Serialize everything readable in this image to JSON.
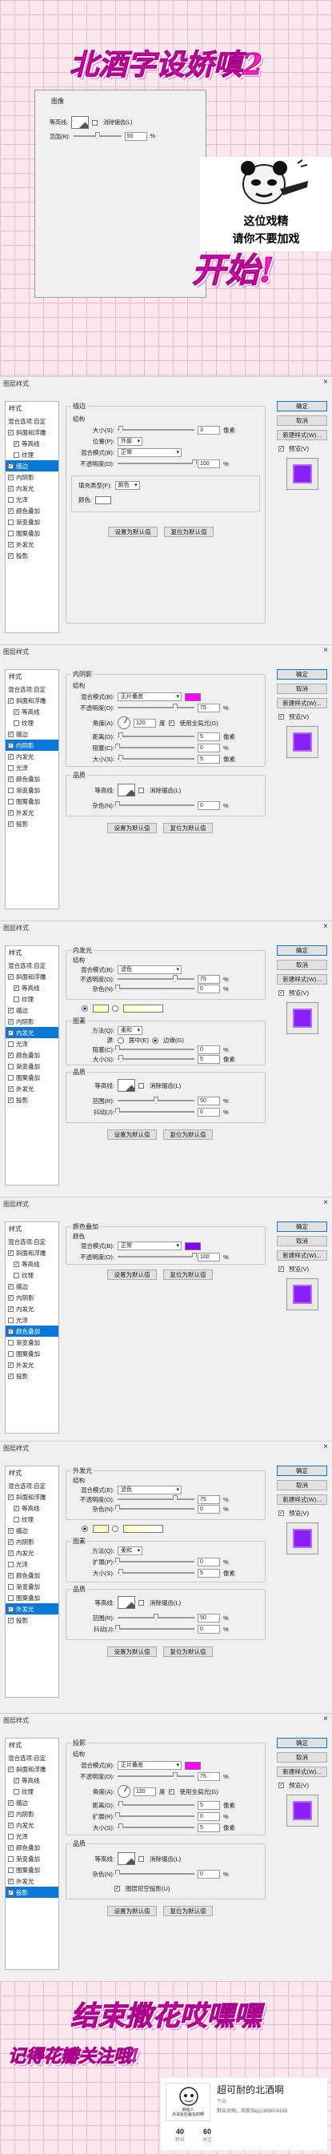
{
  "header": {
    "title": "北酒字设娇嗔2",
    "start": "开始!",
    "mini_panel": {
      "legend": "图像",
      "row1_label": "等高线:",
      "row1_check": "消除锯齿(L)",
      "row2_label": "范围(R):",
      "row2_value": "50",
      "row2_unit": "%"
    },
    "meme": {
      "line1": "这位戏精",
      "line2": "请你不要加戏"
    }
  },
  "common": {
    "dialog_title": "图层样式",
    "close": "×",
    "styles_header": "样式",
    "blend_options": "混合选项:自定",
    "ok": "确定",
    "cancel": "取消",
    "new_style": "新建样式(W)...",
    "preview": "预览(V)",
    "make_default": "设置为默认值",
    "reset_default": "复位为默认值",
    "pixels": "像素",
    "percent": "%"
  },
  "style_items": [
    {
      "label": "斜面和浮雕",
      "checked": true,
      "sub": false
    },
    {
      "label": "等高线",
      "checked": false,
      "sub": true
    },
    {
      "label": "纹理",
      "checked": false,
      "sub": true
    },
    {
      "label": "描边",
      "checked": true,
      "sub": false
    },
    {
      "label": "内阴影",
      "checked": true,
      "sub": false
    },
    {
      "label": "内发光",
      "checked": true,
      "sub": false
    },
    {
      "label": "光泽",
      "checked": false,
      "sub": false
    },
    {
      "label": "颜色叠加",
      "checked": true,
      "sub": false
    },
    {
      "label": "渐变叠加",
      "checked": false,
      "sub": false
    },
    {
      "label": "图案叠加",
      "checked": false,
      "sub": false
    },
    {
      "label": "外发光",
      "checked": true,
      "sub": false
    },
    {
      "label": "投影",
      "checked": true,
      "sub": false
    }
  ],
  "stroke": {
    "title": "描边",
    "structure": "结构",
    "size_label": "大小(S):",
    "size_value": "3",
    "position_label": "位置(P):",
    "position_value": "外部",
    "blend_label": "混合模式(B):",
    "blend_value": "正常",
    "opacity_label": "不透明度(O):",
    "opacity_value": "100",
    "fill_type_label": "填充类型(F):",
    "fill_type_value": "颜色",
    "color_label": "颜色:",
    "color": "#ffffff"
  },
  "inner_shadow": {
    "title": "内阴影",
    "structure": "结构",
    "blend_label": "混合模式(B):",
    "blend_value": "正片叠底",
    "opacity_label": "不透明度(O):",
    "opacity_value": "75",
    "angle_label": "角度(A):",
    "angle_value": "120",
    "angle_unit": "度",
    "global_light": "使用全局光(G)",
    "distance_label": "距离(D):",
    "distance_value": "5",
    "choke_label": "阻塞(C):",
    "choke_value": "0",
    "size_label": "大小(S):",
    "size_value": "5",
    "quality": "品质",
    "contour_label": "等高线:",
    "antialias": "消除锯齿(L)",
    "noise_label": "杂色(N):",
    "noise_value": "0",
    "color": "#ff00ff"
  },
  "inner_glow": {
    "title": "内发光",
    "structure": "结构",
    "blend_label": "混合模式(B):",
    "blend_value": "滤色",
    "opacity_label": "不透明度(O):",
    "opacity_value": "75",
    "noise_label": "杂色(N):",
    "noise_value": "0",
    "elements": "图素",
    "method_label": "方法(Q):",
    "method_value": "柔和",
    "source_label": "源:",
    "source_center": "居中(E)",
    "source_edge": "边缘(G)",
    "choke_label": "阻塞(C):",
    "choke_value": "0",
    "size_label": "大小(S):",
    "size_value": "5",
    "quality": "品质",
    "contour_label": "等高线:",
    "antialias": "消除锯齿(L)",
    "range_label": "范围(R):",
    "range_value": "50",
    "jitter_label": "抖动(J):",
    "jitter_value": "0",
    "color": "#ffffbe"
  },
  "color_overlay": {
    "title": "颜色叠加",
    "section": "颜色",
    "blend_label": "混合模式(B):",
    "blend_value": "正常",
    "opacity_label": "不透明度(O):",
    "opacity_value": "100",
    "color": "#8800ff"
  },
  "outer_glow": {
    "title": "外发光",
    "structure": "结构",
    "blend_label": "混合模式(E):",
    "blend_value": "滤色",
    "opacity_label": "不透明度(O):",
    "opacity_value": "75",
    "noise_label": "杂色(N):",
    "noise_value": "0",
    "elements": "图素",
    "method_label": "方法(Q):",
    "method_value": "柔和",
    "spread_label": "扩展(P):",
    "spread_value": "0",
    "size_label": "大小(S):",
    "size_value": "5",
    "quality": "品质",
    "contour_label": "等高线:",
    "antialias": "消除锯齿(L)",
    "range_label": "范围(R):",
    "range_value": "50",
    "jitter_label": "抖动(J):",
    "jitter_value": "0",
    "color": "#ffffbe"
  },
  "drop_shadow": {
    "title": "投影",
    "structure": "结构",
    "blend_label": "混合模式(B):",
    "blend_value": "正片叠底",
    "opacity_label": "不透明度(O):",
    "opacity_value": "75",
    "angle_label": "角度(A):",
    "angle_value": "120",
    "angle_unit": "度",
    "global_light": "使用全局光(G)",
    "distance_label": "距离(D):",
    "distance_value": "5",
    "spread_label": "扩展(R):",
    "spread_value": "0",
    "size_label": "大小(S):",
    "size_value": "5",
    "quality": "品质",
    "contour_label": "等高线:",
    "antialias": "消除锯齿(L)",
    "noise_label": "杂色(N):",
    "noise_value": "0",
    "knockout": "图层挖空投影(U)",
    "color": "#ff00ff"
  },
  "footer": {
    "end": "结束撒花哎嘿嘿",
    "follow": "记得花瓣关注哦!",
    "card_name": "超可耐的北酒啊",
    "card_sub": "不苦",
    "card_meta": "默告对图，商家加qq1365004165",
    "avatar_text": "来给人\n点没反应最在的啊",
    "stat1_value": "40",
    "stat1_label": "粉丝",
    "stat2_value": "60",
    "stat2_label": "关注"
  }
}
